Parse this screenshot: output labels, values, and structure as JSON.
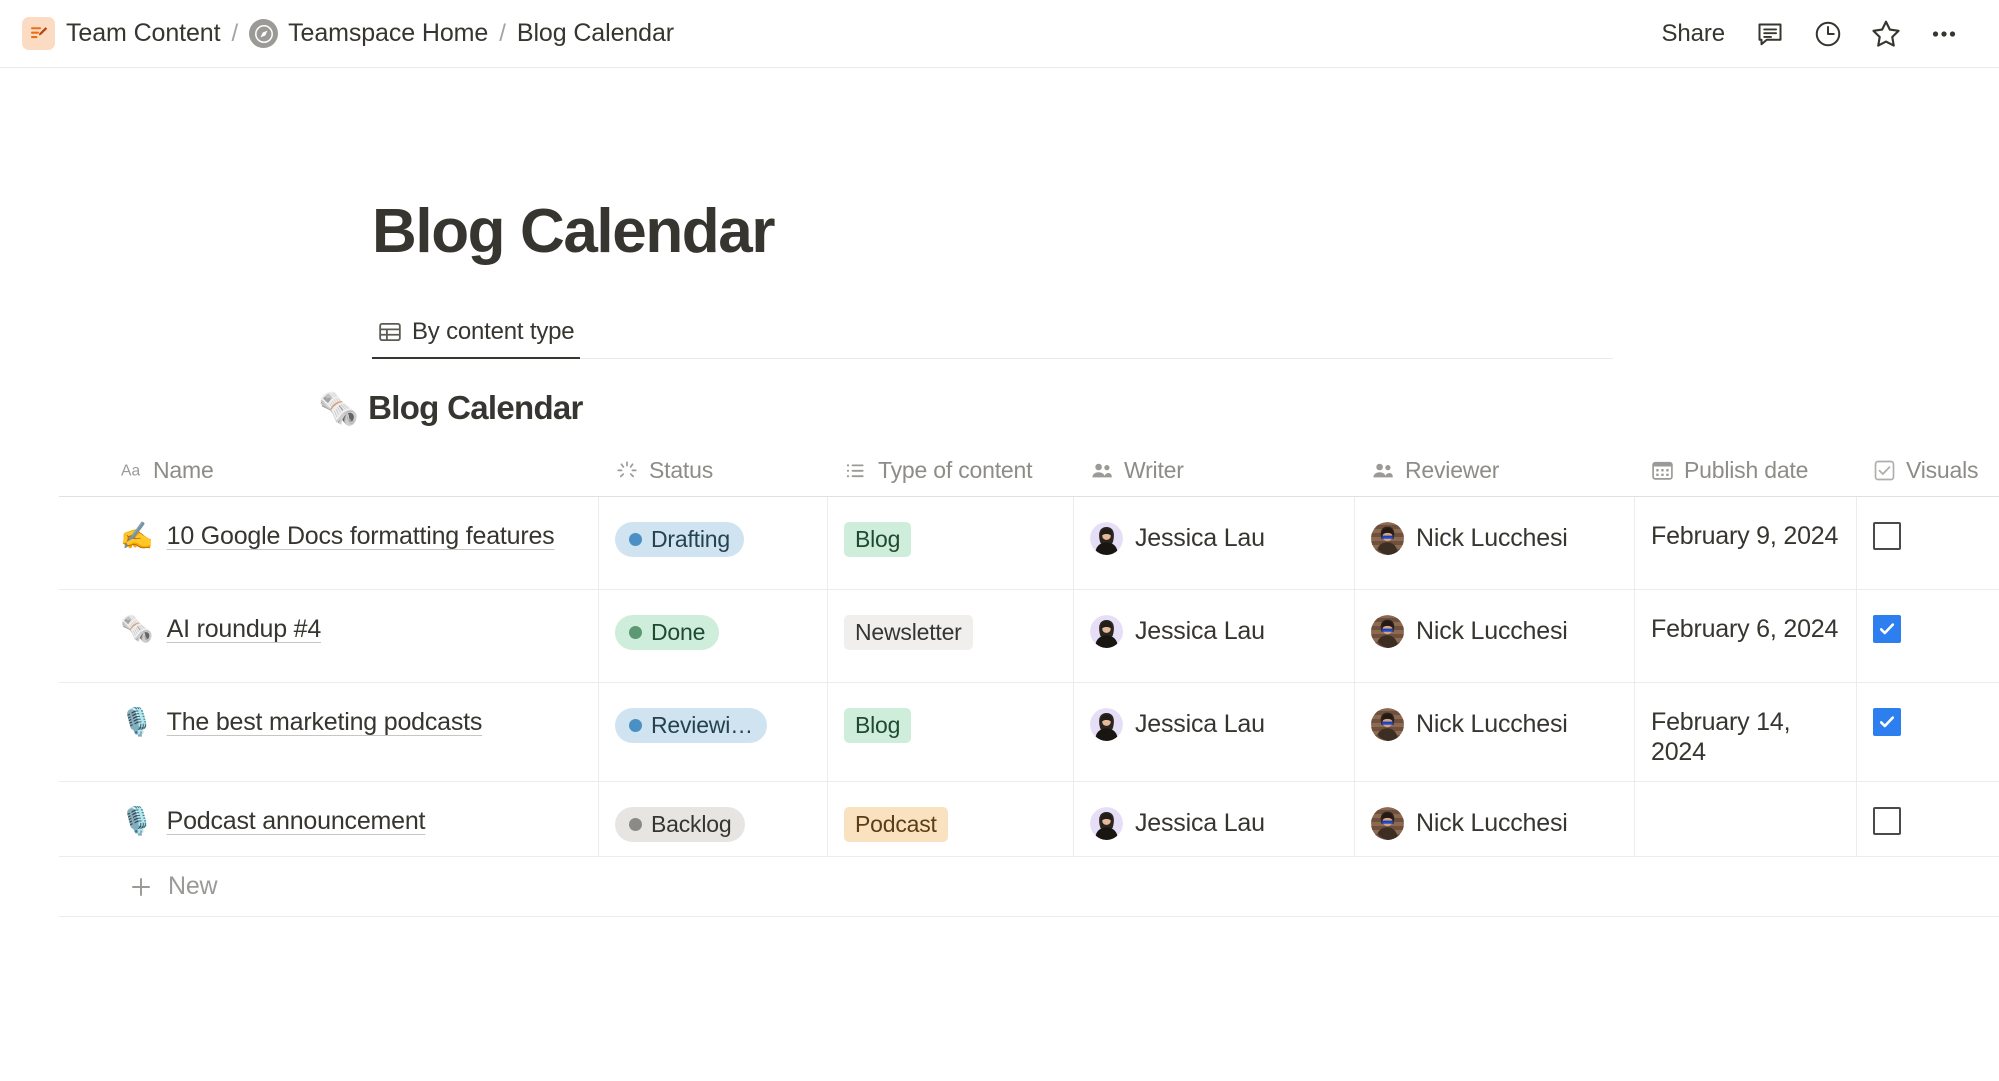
{
  "topbar": {
    "breadcrumb": {
      "workspace_icon": "edit-document-icon",
      "workspace_label": "Team Content",
      "sep1": "/",
      "teamspace_icon": "compass-icon",
      "teamspace_label": "Teamspace Home",
      "sep2": "/",
      "page_label": "Blog Calendar"
    },
    "share_label": "Share",
    "icons": {
      "comment": "comment-icon",
      "history": "clock-history-icon",
      "favorite": "star-icon",
      "more": "more-options-icon"
    }
  },
  "page": {
    "title": "Blog Calendar",
    "view_tab": {
      "icon": "table-view-icon",
      "label": "By content type"
    },
    "database": {
      "emoji": "🗞️",
      "title": "Blog Calendar"
    }
  },
  "table": {
    "columns": [
      {
        "key": "name",
        "label": "Name",
        "icon": "text-property-icon"
      },
      {
        "key": "status",
        "label": "Status",
        "icon": "status-property-icon"
      },
      {
        "key": "type",
        "label": "Type of content",
        "icon": "select-property-icon"
      },
      {
        "key": "writer",
        "label": "Writer",
        "icon": "person-property-icon"
      },
      {
        "key": "review",
        "label": "Reviewer",
        "icon": "person-property-icon"
      },
      {
        "key": "date",
        "label": "Publish date",
        "icon": "date-property-icon"
      },
      {
        "key": "visual",
        "label": "Visuals",
        "icon": "checkbox-property-icon"
      }
    ],
    "rows": [
      {
        "emoji": "✍️",
        "name": "10 Google Docs formatting features",
        "status": {
          "label": "Drafting",
          "dot_color": "#4a90c4",
          "bg": "#cfe4f0",
          "text_color": "#24434f"
        },
        "type": {
          "label": "Blog",
          "bg": "#cfeddb",
          "text_color": "#1f4a30"
        },
        "writer": "Jessica Lau",
        "reviewer": "Nick Lucchesi",
        "date": "February 9, 2024",
        "visual_checked": false
      },
      {
        "emoji": "🗞️",
        "name": "AI roundup #4",
        "status": {
          "label": "Done",
          "dot_color": "#5b9873",
          "bg": "#cfeddb",
          "text_color": "#1f4a30"
        },
        "type": {
          "label": "Newsletter",
          "bg": "#f0efed",
          "text_color": "#37352f"
        },
        "writer": "Jessica Lau",
        "reviewer": "Nick Lucchesi",
        "date": "February 6, 2024",
        "visual_checked": true
      },
      {
        "emoji": "🎙️",
        "name": "The best marketing podcasts",
        "status": {
          "label": "Reviewi…",
          "dot_color": "#4a90c4",
          "bg": "#cfe4f0",
          "text_color": "#24434f"
        },
        "type": {
          "label": "Blog",
          "bg": "#cfeddb",
          "text_color": "#1f4a30"
        },
        "writer": "Jessica Lau",
        "reviewer": "Nick Lucchesi",
        "date": "February 14, 2024",
        "visual_checked": true
      },
      {
        "emoji": "🎙️",
        "name": "Podcast announcement",
        "status": {
          "label": "Backlog",
          "dot_color": "#8b8a86",
          "bg": "#e6e5e2",
          "text_color": "#37352f"
        },
        "type": {
          "label": "Podcast",
          "bg": "#fae2c0",
          "text_color": "#5b3d16"
        },
        "writer": "Jessica Lau",
        "reviewer": "Nick Lucchesi",
        "date": "",
        "visual_checked": false
      }
    ],
    "new_row": {
      "icon": "plus-icon",
      "label": "New"
    }
  },
  "colors": {
    "accent_blue": "#2d7ff0",
    "text_primary": "#37352f",
    "text_muted": "#9b9a97",
    "border": "#edece9"
  }
}
